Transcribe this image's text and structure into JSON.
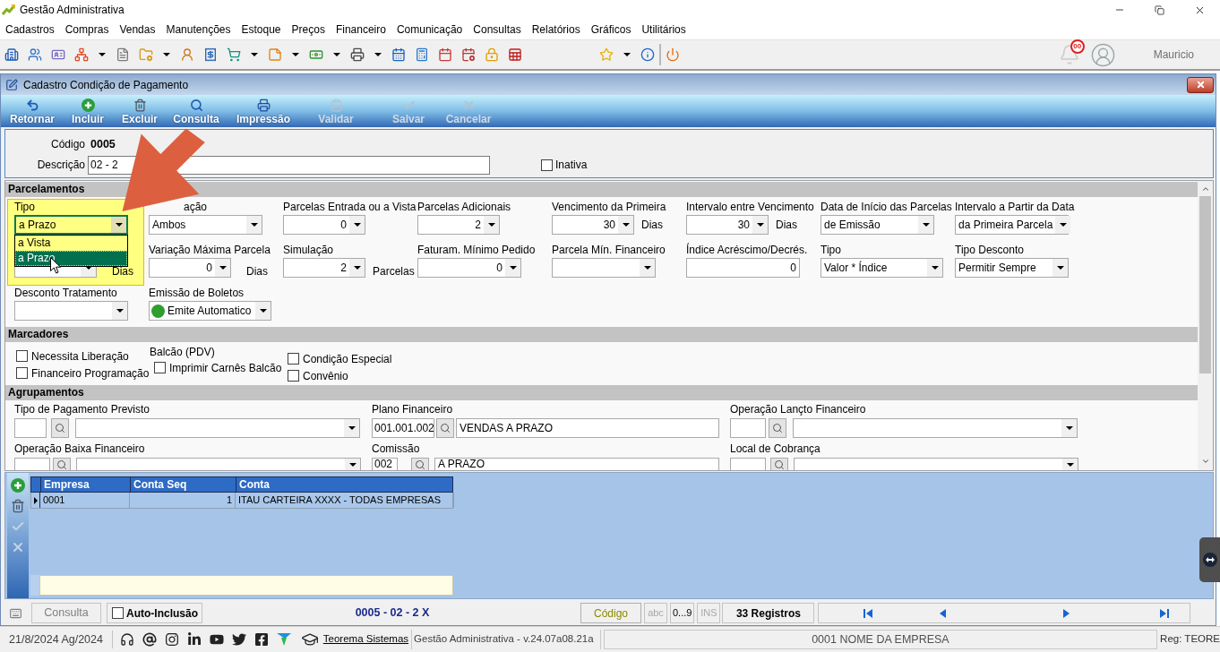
{
  "window": {
    "title": "Gestão Administrativa"
  },
  "menu": [
    "Cadastros",
    "Compras",
    "Vendas",
    "Manutenções",
    "Estoque",
    "Preços",
    "Financeiro",
    "Comunicação",
    "Consultas",
    "Relatórios",
    "Gráficos",
    "Utilitários"
  ],
  "user": {
    "notifications": "00",
    "name": "Mauricio"
  },
  "annotations": {
    "highlight": true,
    "arrow": true
  },
  "form": {
    "title": "Cadastro Condição de Pagamento",
    "actions": [
      {
        "label": "Retornar",
        "kind": "back",
        "disabled": false
      },
      {
        "label": "Incluir",
        "kind": "add",
        "disabled": false
      },
      {
        "label": "Excluir",
        "kind": "delete",
        "disabled": false
      },
      {
        "label": "Consulta",
        "kind": "search",
        "disabled": false
      },
      {
        "label": "Impressão",
        "kind": "print",
        "disabled": false
      },
      {
        "label": "Validar",
        "kind": "validate",
        "disabled": true
      },
      {
        "label": "Salvar",
        "kind": "save",
        "disabled": true
      },
      {
        "label": "Cancelar",
        "kind": "cancel",
        "disabled": true
      }
    ],
    "header": {
      "code_label": "Código",
      "code": "0005",
      "description_label": "Descrição",
      "description": "02 - 2",
      "inactive": {
        "label": "Inativa",
        "checked": false
      }
    },
    "parcelamentos": {
      "title": "Parcelamentos",
      "rows": [
        [
          {
            "label": "Tipo",
            "kind": "combo",
            "value": "a Prazo",
            "expanded": true,
            "options": [
              {
                "label": "a Vista",
                "selected": false
              },
              {
                "label": "a Prazo",
                "selected": true
              }
            ]
          },
          {
            "label": "ação",
            "kind": "combo",
            "value": "Ambos",
            "expanded": false
          },
          {
            "label": "Parcelas Entrada ou a Vista",
            "kind": "spin",
            "value": "0",
            "expanded": false
          },
          {
            "label": "Parcelas Adicionais",
            "kind": "spin",
            "value": "2",
            "expanded": false
          },
          {
            "label": "Vencimento da Primeira",
            "kind": "spin",
            "value": "30",
            "suffix": "Dias",
            "expanded": false
          },
          {
            "label": "Intervalo entre Vencimento",
            "kind": "spin",
            "value": "30",
            "suffix": "Dias",
            "expanded": false
          },
          {
            "label": "Data de Início das Parcelas",
            "kind": "combo",
            "value": "de Emissão",
            "expanded": false
          },
          {
            "label": "Intervalo a Partir da Data",
            "kind": "combo",
            "value": "da Primeira Parcela",
            "expanded": false
          }
        ],
        [
          {
            "kind": "spin",
            "suffix": "Dias",
            "expanded": false
          },
          {
            "label": "Variação Máxima Parcela",
            "kind": "spin",
            "value": "0",
            "suffix": "Dias",
            "expanded": false
          },
          {
            "label": "Simulação",
            "kind": "spin",
            "value": "2",
            "suffix": "Parcelas",
            "expanded": false
          },
          {
            "label": "Faturam. Mínimo Pedido",
            "kind": "spin",
            "value": "0",
            "expanded": false
          },
          {
            "label": "Parcela Mín. Financeiro",
            "kind": "combo",
            "expanded": false
          },
          {
            "label": "Índice Acréscimo/Decrés.",
            "kind": "input",
            "value": "0",
            "expanded": false
          },
          {
            "label": "Tipo",
            "kind": "combo",
            "value": "Valor * Índice",
            "expanded": false
          },
          {
            "label": "Tipo Desconto",
            "kind": "combo",
            "value": "Permitir Sempre",
            "expanded": false
          }
        ],
        [
          {
            "label": "Desconto Tratamento",
            "kind": "combo",
            "expanded": false
          },
          {
            "label": "Emissão de Boletos",
            "kind": "combo",
            "value": "Emite Automatico",
            "color": "#2e9e2e",
            "expanded": false
          }
        ]
      ]
    },
    "marcadores": {
      "title": "Marcadores",
      "groups": [
        {
          "items": [
            {
              "label": "Necessita Liberação",
              "checked": false
            },
            {
              "label": "Financeiro Programação",
              "checked": false
            }
          ]
        },
        {
          "title": "Balcão (PDV)",
          "items": [
            {
              "label": "Imprimir Carnês Balcão",
              "checked": false
            }
          ]
        },
        {
          "items": [
            {
              "label": "Condição Especial",
              "checked": false
            },
            {
              "label": "Convênio",
              "checked": false
            }
          ]
        }
      ]
    },
    "agrupamentos": {
      "title": "Agrupamentos",
      "rows": [
        [
          {
            "label": "Tipo de Pagamento Previsto",
            "kind": "combo"
          },
          {
            "label": "Plano Financeiro",
            "code": "001.001.002",
            "kind": "text",
            "value": "VENDAS A PRAZO"
          },
          {
            "label": "Operação Lançto Financeiro",
            "kind": "combo"
          }
        ],
        [
          {
            "label": "Operação Baixa Financeiro",
            "kind": "combo"
          },
          {
            "label": "Comissão",
            "code": "002",
            "kind": "text",
            "value": "A PRAZO"
          },
          {
            "label": "Local de Cobrança",
            "kind": "combo"
          }
        ]
      ]
    },
    "grid": {
      "tools": [
        {
          "kind": "add",
          "disabled": false
        },
        {
          "kind": "delete",
          "disabled": false
        },
        {
          "kind": "confirm",
          "disabled": true
        },
        {
          "kind": "cancel",
          "disabled": true
        }
      ],
      "columns": [
        "Empresa",
        "Conta Seq",
        "Conta"
      ],
      "rows": [
        {
          "cells": [
            "0001",
            "1",
            "ITAU CARTEIRA XXXX - TODAS EMPRESAS"
          ],
          "selected": true
        }
      ]
    },
    "status": {
      "mode": "Consulta",
      "auto_inclusion": {
        "label": "Auto-Inclusão",
        "checked": false
      },
      "record": "0005 - 02 - 2 X",
      "order": "Código",
      "indicators": [
        {
          "label": "abc",
          "on": false
        },
        {
          "label": "0...9",
          "on": true
        },
        {
          "label": "INS",
          "on": false
        }
      ],
      "count": "33 Registros"
    }
  },
  "footer": {
    "date": "21/8/2024 Ag/2024",
    "link": "Teorema Sistemas",
    "version": "Gestão Administrativa - v.24.07a08.21a",
    "company": "0001 NOME DA EMPRESA",
    "registration": "Reg: TEORE"
  }
}
